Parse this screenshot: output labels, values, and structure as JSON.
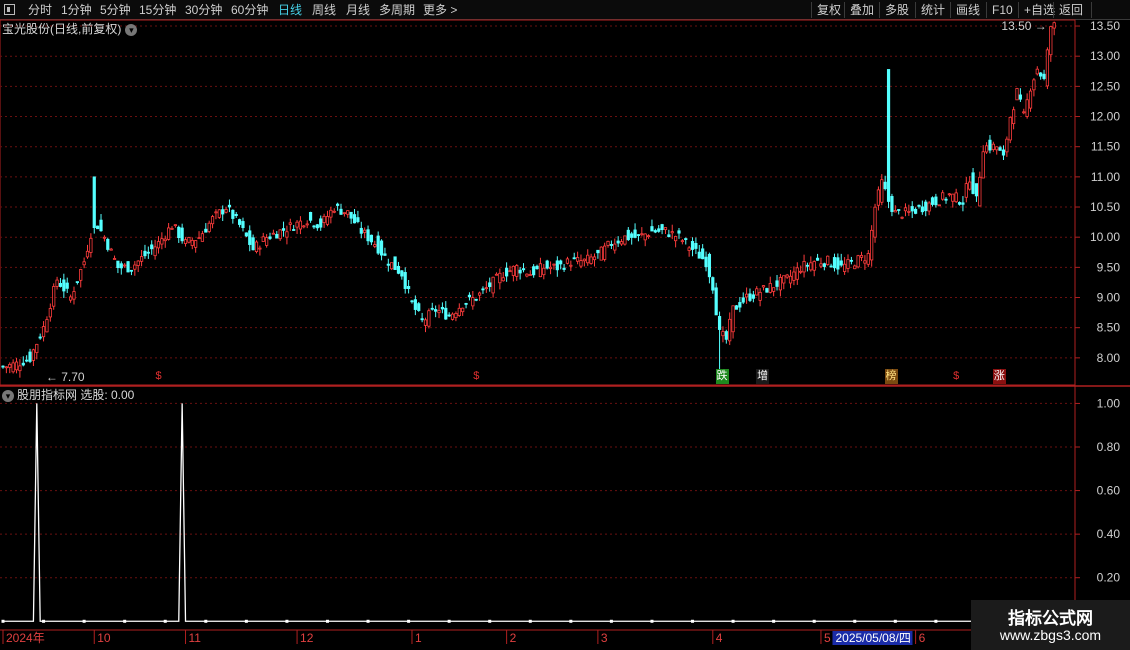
{
  "toolbar": {
    "left_items": [
      "分时",
      "1分钟",
      "5分钟",
      "15分钟",
      "30分钟",
      "60分钟",
      "日线",
      "周线",
      "月线",
      "多周期",
      "更多 >"
    ],
    "active_index": 6,
    "right_items": [
      "复权",
      "叠加",
      "多股",
      "统计",
      "画线",
      "F10",
      "+自选",
      "返回"
    ]
  },
  "main_panel": {
    "title": "宝光股份(日线,前复权)"
  },
  "indicator_panel": {
    "title": "股朋指标网 选股: 0.00"
  },
  "signal_tags": [
    {
      "label": "$",
      "color": "#e03030",
      "bg": "",
      "index": 46
    },
    {
      "label": "$",
      "color": "#e03030",
      "bg": "",
      "index": 140
    },
    {
      "label": "跌",
      "color": "#ffffff",
      "bg": "#1f8a1f",
      "index": 212
    },
    {
      "label": "增",
      "color": "#ffffff",
      "bg": "#1a1a1a",
      "index": 224
    },
    {
      "label": "榜",
      "color": "#ffe080",
      "bg": "#7a4a10",
      "index": 262
    },
    {
      "label": "$",
      "color": "#e03030",
      "bg": "",
      "index": 282
    },
    {
      "label": "涨",
      "color": "#ffffff",
      "bg": "#8a1010",
      "index": 294
    }
  ],
  "price_annotations": {
    "low_label": "7.70",
    "high_label": "13.50"
  },
  "date_axis": {
    "labels": [
      {
        "text": "2024年",
        "index": 0
      },
      {
        "text": "10",
        "index": 27
      },
      {
        "text": "11",
        "index": 54
      },
      {
        "text": "12",
        "index": 87
      },
      {
        "text": "1",
        "index": 121
      },
      {
        "text": "2",
        "index": 149
      },
      {
        "text": "3",
        "index": 176
      },
      {
        "text": "4",
        "index": 210
      },
      {
        "text": "5",
        "index": 242
      },
      {
        "text": "6",
        "index": 270
      }
    ],
    "highlight": {
      "text": "2025/05/08/四",
      "index": 246
    }
  },
  "watermark": {
    "line1": "指标公式网",
    "line2": "www.zbgs3.com"
  },
  "colors": {
    "up": "#ff3c3c",
    "down": "#54ffff",
    "grid": "#6a1010",
    "axis": "#b02020",
    "accent": "#46d1e8"
  },
  "chart_data": [
    {
      "type": "candlestick",
      "title": "宝光股份(日线,前复权)",
      "y_ticks": [
        8.0,
        8.5,
        9.0,
        9.5,
        10.0,
        10.5,
        11.0,
        11.5,
        12.0,
        12.5,
        13.0,
        13.5
      ],
      "ylim": [
        7.55,
        13.6
      ],
      "low": 7.7,
      "high": 13.5,
      "close_path": [
        [
          0,
          7.85
        ],
        [
          4,
          7.9
        ],
        [
          8,
          8.0
        ],
        [
          12,
          8.5
        ],
        [
          16,
          9.3
        ],
        [
          20,
          9.0
        ],
        [
          24,
          9.6
        ],
        [
          27,
          10.3
        ],
        [
          30,
          10.0
        ],
        [
          34,
          9.5
        ],
        [
          38,
          9.5
        ],
        [
          42,
          9.7
        ],
        [
          46,
          9.9
        ],
        [
          50,
          10.2
        ],
        [
          54,
          9.9
        ],
        [
          58,
          10.0
        ],
        [
          62,
          10.3
        ],
        [
          66,
          10.5
        ],
        [
          70,
          10.2
        ],
        [
          74,
          9.8
        ],
        [
          78,
          10.0
        ],
        [
          82,
          10.1
        ],
        [
          86,
          10.2
        ],
        [
          90,
          10.3
        ],
        [
          94,
          10.2
        ],
        [
          98,
          10.5
        ],
        [
          102,
          10.4
        ],
        [
          106,
          10.1
        ],
        [
          110,
          9.9
        ],
        [
          114,
          9.6
        ],
        [
          118,
          9.4
        ],
        [
          121,
          8.9
        ],
        [
          124,
          8.6
        ],
        [
          128,
          8.8
        ],
        [
          132,
          8.7
        ],
        [
          136,
          8.9
        ],
        [
          140,
          9.0
        ],
        [
          144,
          9.2
        ],
        [
          148,
          9.4
        ],
        [
          152,
          9.5
        ],
        [
          156,
          9.4
        ],
        [
          160,
          9.5
        ],
        [
          164,
          9.5
        ],
        [
          168,
          9.6
        ],
        [
          172,
          9.6
        ],
        [
          176,
          9.7
        ],
        [
          180,
          9.9
        ],
        [
          184,
          10.0
        ],
        [
          188,
          10.0
        ],
        [
          192,
          10.1
        ],
        [
          196,
          10.1
        ],
        [
          200,
          10.0
        ],
        [
          204,
          9.8
        ],
        [
          208,
          9.6
        ],
        [
          210,
          9.2
        ],
        [
          212,
          8.4
        ],
        [
          214,
          8.3
        ],
        [
          216,
          8.8
        ],
        [
          220,
          9.0
        ],
        [
          224,
          9.1
        ],
        [
          228,
          9.2
        ],
        [
          232,
          9.3
        ],
        [
          236,
          9.5
        ],
        [
          240,
          9.6
        ],
        [
          244,
          9.6
        ],
        [
          248,
          9.5
        ],
        [
          252,
          9.6
        ],
        [
          256,
          9.7
        ],
        [
          258,
          10.5
        ],
        [
          260,
          10.9
        ],
        [
          262,
          10.6
        ],
        [
          264,
          10.4
        ],
        [
          268,
          10.4
        ],
        [
          272,
          10.5
        ],
        [
          276,
          10.6
        ],
        [
          280,
          10.7
        ],
        [
          284,
          10.6
        ],
        [
          286,
          11.0
        ],
        [
          288,
          10.6
        ],
        [
          290,
          11.5
        ],
        [
          294,
          11.5
        ],
        [
          296,
          11.3
        ],
        [
          298,
          12.0
        ],
        [
          300,
          12.4
        ],
        [
          302,
          12.0
        ],
        [
          304,
          12.5
        ],
        [
          306,
          12.8
        ],
        [
          308,
          12.6
        ],
        [
          310,
          13.5
        ]
      ],
      "spikes": [
        {
          "index": 27,
          "high": 11.0,
          "color": "down"
        },
        {
          "index": 262,
          "high": 12.78,
          "color": "down"
        },
        {
          "index": 212,
          "low": 7.7,
          "color": "down"
        },
        {
          "index": 310,
          "high": 13.5,
          "color": "up"
        }
      ]
    },
    {
      "type": "line",
      "title": "股朋指标网 选股: 0.00",
      "y_ticks": [
        0.2,
        0.4,
        0.6,
        0.8,
        1.0
      ],
      "ylim": [
        -0.04,
        1.08
      ],
      "spikes_at": [
        10,
        53
      ],
      "markers_every": 12,
      "baseline": 0.0,
      "peak": 1.0
    }
  ]
}
